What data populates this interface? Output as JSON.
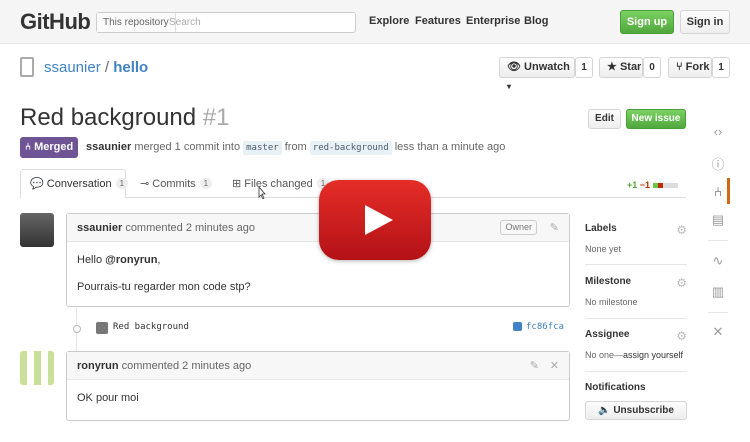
{
  "header": {
    "logo": "GitHub",
    "search_scope": "This repository",
    "search_placeholder": "Search",
    "nav": [
      "Explore",
      "Features",
      "Enterprise",
      "Blog"
    ],
    "signup": "Sign up",
    "signin": "Sign in"
  },
  "repo": {
    "owner": "ssaunier",
    "separator": "/",
    "name": "hello",
    "unwatch_label": "Unwatch",
    "unwatch_count": "1",
    "star_label": "Star",
    "star_count": "0",
    "fork_label": "Fork",
    "fork_count": "1"
  },
  "pr": {
    "title": "Red background",
    "number": "#1",
    "edit_label": "Edit",
    "new_issue_label": "New issue",
    "state_badge": "Merged",
    "author": "ssaunier",
    "merge_text": "merged 1 commit into",
    "base_branch": "master",
    "from_text": "from",
    "head_branch": "red-background",
    "time_text": "less than a minute ago"
  },
  "tabs": [
    {
      "label": "Conversation",
      "count": "1"
    },
    {
      "label": "Commits",
      "count": "1"
    },
    {
      "label": "Files changed",
      "count": "1"
    }
  ],
  "diffstat": {
    "additions": "+1",
    "deletions": "−1"
  },
  "colors": {
    "merged": "#6e5494",
    "green": "#55a532",
    "red": "#bd2c00",
    "link": "#4183c4",
    "play": "#e52d27"
  },
  "comments": [
    {
      "author": "ssaunier",
      "meta": "commented 2 minutes ago",
      "badge": "Owner",
      "lines": [
        "Hello @ronyrun,",
        "Pourrais-tu regarder mon code stp?"
      ]
    },
    {
      "author": "ronyrun",
      "meta": "commented 2 minutes ago",
      "lines": [
        "OK pour moi"
      ]
    }
  ],
  "commit": {
    "message": "Red background",
    "sha": "fc86fca"
  },
  "sidebar": {
    "labels_h": "Labels",
    "labels_v": "None yet",
    "milestone_h": "Milestone",
    "milestone_v": "No milestone",
    "assignee_h": "Assignee",
    "assignee_v_prefix": "No one—",
    "assignee_v_link": "assign yourself",
    "notifications_h": "Notifications",
    "unsubscribe": "Unsubscribe"
  },
  "icons": {
    "sidenav": [
      "code-icon",
      "issue-icon",
      "pull-request-icon",
      "wiki-icon",
      "pulse-icon",
      "graphs-icon",
      "settings-icon"
    ]
  }
}
